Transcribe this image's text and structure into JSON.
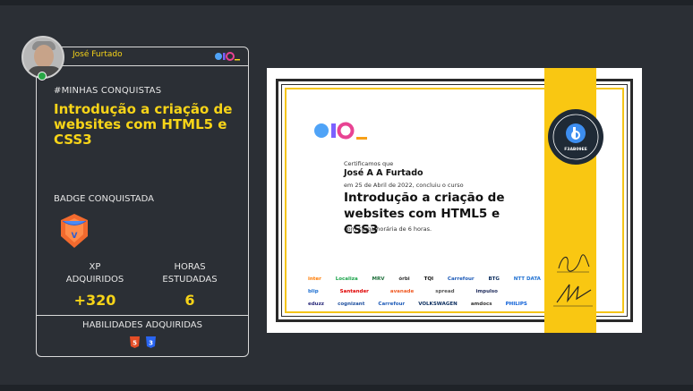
{
  "profile": {
    "name": "José Furtado"
  },
  "section_tag": "#MINHAS CONQUISTAS",
  "course_title": "Introdução a criação de websites com HTML5 e CSS3",
  "badge_label": "BADGE CONQUISTADA",
  "stats": {
    "xp_label": "XP ADQUIRIDOS",
    "xp_value": "+320",
    "hours_label": "HORAS ESTUDADAS",
    "hours_value": "6"
  },
  "skills_label": "HABILIDADES ADQUIRIDAS",
  "skills": [
    {
      "icon": "html5-icon",
      "glyph": "5",
      "color": "#e44d26"
    },
    {
      "icon": "css3-icon",
      "glyph": "3",
      "color": "#2965f1"
    }
  ],
  "certificate": {
    "line1": "Certificamos que",
    "student": "José A A Furtado",
    "line2": "em 25 de Abril de 2022, concluiu o curso",
    "title": "Introdução a criação de websites com HTML5 e CSS3",
    "line3": "com carga horária de 6 horas.",
    "seal_code": "F3AB09EE",
    "partners": [
      [
        "inter",
        "Localiza",
        "MRV",
        "órbi",
        "TQI",
        "Carrefour",
        "BTG",
        "NTT DATA"
      ],
      [
        "blip",
        "Santander",
        "avanade",
        "spread",
        "impulso",
        "",
        "",
        ""
      ],
      [
        "eduzz",
        "cognizant",
        "Carrefour",
        "VOLKSWAGEN",
        "amdocs",
        "PHILIPS",
        ""
      ]
    ]
  },
  "colors": {
    "accent": "#f7d418",
    "background": "#2b2f35",
    "ribbon": "#f9c712"
  }
}
